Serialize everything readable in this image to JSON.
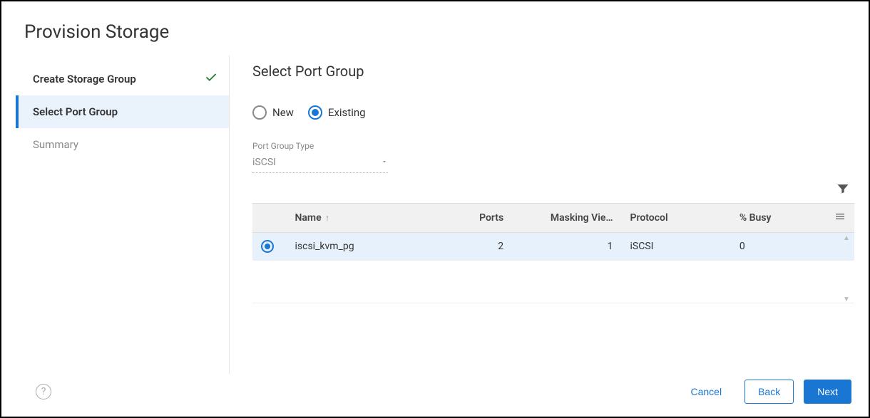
{
  "title": "Provision Storage",
  "sidebar": {
    "steps": [
      {
        "label": "Create Storage Group",
        "state": "completed"
      },
      {
        "label": "Select Port Group",
        "state": "active"
      },
      {
        "label": "Summary",
        "state": "pending"
      }
    ]
  },
  "main": {
    "heading": "Select Port Group",
    "mode": {
      "new_label": "New",
      "existing_label": "Existing",
      "selected": "existing"
    },
    "port_group_type": {
      "label": "Port Group Type",
      "value": "iSCSI"
    },
    "table": {
      "columns": {
        "name": "Name",
        "ports": "Ports",
        "masking": "Masking Vie…",
        "protocol": "Protocol",
        "busy": "% Busy"
      },
      "rows": [
        {
          "selected": true,
          "name": "iscsi_kvm_pg",
          "ports": "2",
          "masking": "1",
          "protocol": "iSCSI",
          "busy": "0"
        }
      ]
    }
  },
  "footer": {
    "cancel": "Cancel",
    "back": "Back",
    "next": "Next"
  }
}
